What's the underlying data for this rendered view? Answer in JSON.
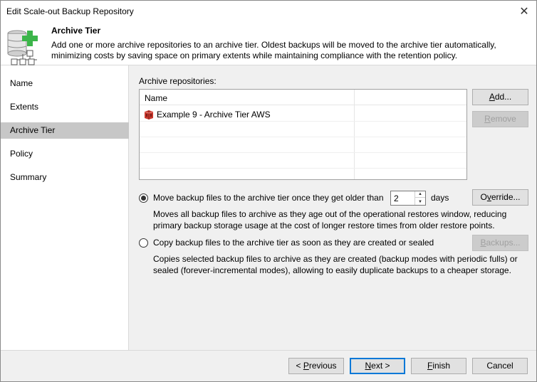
{
  "window": {
    "title": "Edit Scale-out Backup Repository"
  },
  "header": {
    "title": "Archive Tier",
    "description": "Add one or more archive repositories to an archive tier. Oldest backups will be moved to the archive tier automatically, minimizing costs by saving space on primary extents while maintaining compliance with the retention policy."
  },
  "sidebar": {
    "items": [
      {
        "label": "Name"
      },
      {
        "label": "Extents"
      },
      {
        "label": "Archive Tier"
      },
      {
        "label": "Policy"
      },
      {
        "label": "Summary"
      }
    ],
    "active_index": 2
  },
  "main": {
    "repos_label": "Archive repositories:",
    "table": {
      "column": "Name",
      "rows": [
        {
          "name": "Example 9 - Archive Tier AWS",
          "icon": "aws-bucket-icon"
        }
      ]
    },
    "buttons": {
      "add": "Add...",
      "remove": "Remove",
      "override": "Override...",
      "backups": "Backups..."
    },
    "option_move": {
      "label": "Move backup files to the archive tier once they get older than",
      "value": "2",
      "unit": "days",
      "selected": true,
      "description": "Moves all backup files to archive as they age out of the operational restores window, reducing primary backup storage usage at the cost of longer restore times from older restore points."
    },
    "option_copy": {
      "label": "Copy backup files to the archive tier as soon as they are created or sealed",
      "selected": false,
      "description": "Copies selected backup files to archive as they are created (backup modes with periodic fulls) or sealed (forever-incremental modes), allowing to easily duplicate backups to a cheaper storage."
    }
  },
  "footer": {
    "previous": "< Previous",
    "next": "Next >",
    "finish": "Finish",
    "cancel": "Cancel"
  },
  "colors": {
    "active_nav": "#c7c7c7",
    "accent_green": "#3cb54a",
    "aws_red": "#c7352b"
  }
}
